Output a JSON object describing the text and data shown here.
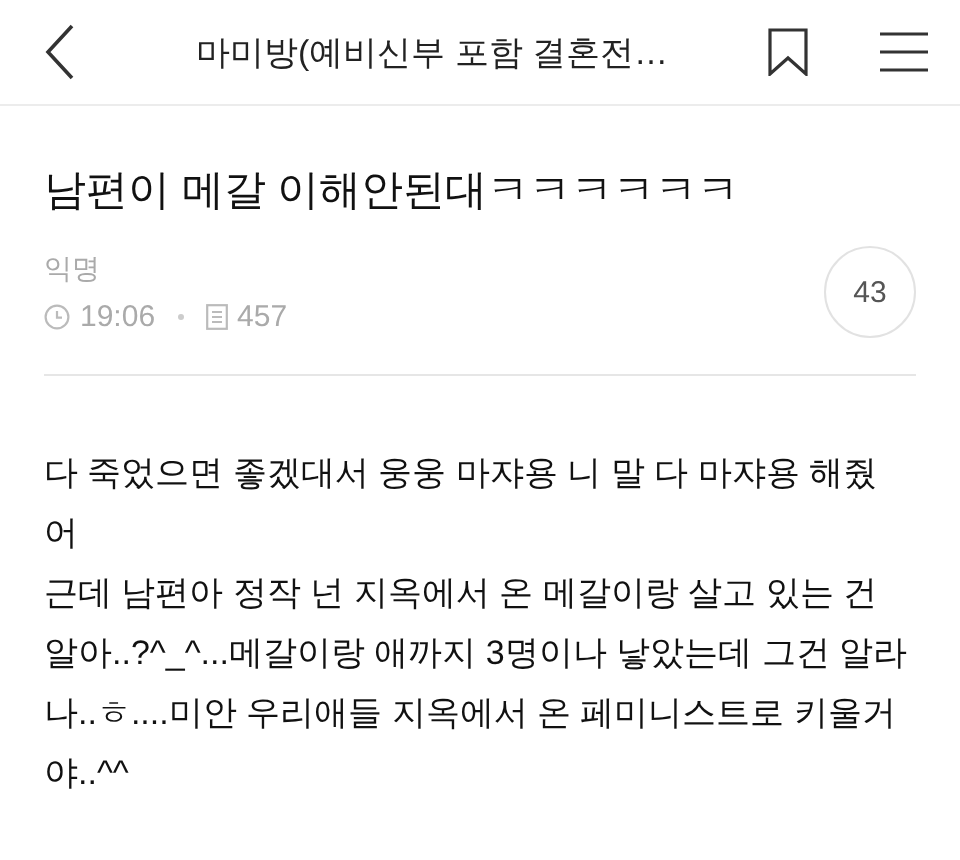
{
  "header": {
    "title": "마미방(예비신부 포함 결혼전…"
  },
  "post": {
    "title": "남편이 메갈 이해안된대ㅋㅋㅋㅋㅋㅋ",
    "author": "익명",
    "time": "19:06",
    "views": "457",
    "comment_count": "43"
  },
  "body_lines": [
    "다 죽었으면 좋겠대서 웅웅 마쟈용 니 말 다 마쟈용 해줬",
    "어",
    "근데 남편아 정작 넌 지옥에서 온 메갈이랑 살고 있는 건",
    "알아..?^_^...메갈이랑 애까지 3명이나 낳았는데 그건 알라",
    "나..ㅎ....미안 우리애들 지옥에서 온 페미니스트로 키울거",
    "야..^^"
  ]
}
